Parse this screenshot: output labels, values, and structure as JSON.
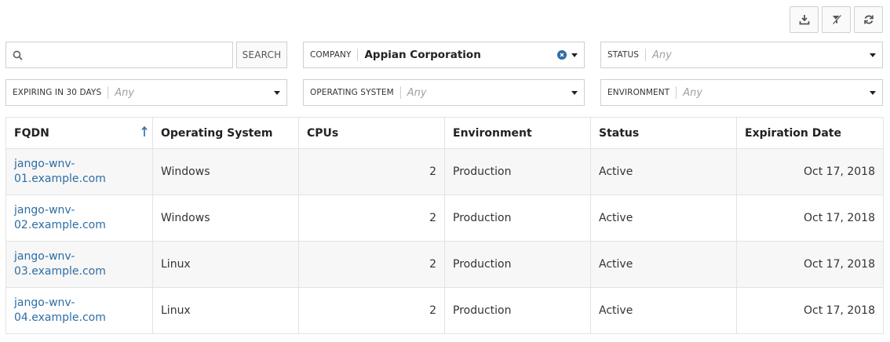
{
  "toolbar": {
    "download_icon": "download-icon",
    "clear_filters_icon": "clear-filters-icon",
    "refresh_icon": "refresh-icon"
  },
  "search": {
    "placeholder": "",
    "value": "",
    "button_label": "SEARCH"
  },
  "filters": {
    "company": {
      "label": "COMPANY",
      "value": "Appian Corporation"
    },
    "status": {
      "label": "STATUS",
      "value": "Any"
    },
    "expiring": {
      "label": "EXPIRING IN 30 DAYS",
      "value": "Any"
    },
    "os": {
      "label": "OPERATING SYSTEM",
      "value": "Any"
    },
    "environment": {
      "label": "ENVIRONMENT",
      "value": "Any"
    }
  },
  "table": {
    "columns": [
      "FQDN",
      "Operating System",
      "CPUs",
      "Environment",
      "Status",
      "Expiration Date"
    ],
    "sort_icon": "sort-ascending-icon",
    "rows": [
      {
        "fqdn_1": "jango-wnv-",
        "fqdn_2": "01.example.com",
        "os": "Windows",
        "cpus": "2",
        "environment": "Production",
        "status": "Active",
        "expiration": "Oct 17, 2018"
      },
      {
        "fqdn_1": "jango-wnv-",
        "fqdn_2": "02.example.com",
        "os": "Windows",
        "cpus": "2",
        "environment": "Production",
        "status": "Active",
        "expiration": "Oct 17, 2018"
      },
      {
        "fqdn_1": "jango-wnv-",
        "fqdn_2": "03.example.com",
        "os": "Linux",
        "cpus": "2",
        "environment": "Production",
        "status": "Active",
        "expiration": "Oct 17, 2018"
      },
      {
        "fqdn_1": "jango-wnv-",
        "fqdn_2": "04.example.com",
        "os": "Linux",
        "cpus": "2",
        "environment": "Production",
        "status": "Active",
        "expiration": "Oct 17, 2018"
      }
    ]
  },
  "colors": {
    "link": "#2e6da4",
    "border": "#cfcfcf",
    "row_alt": "#f7f7f7"
  }
}
